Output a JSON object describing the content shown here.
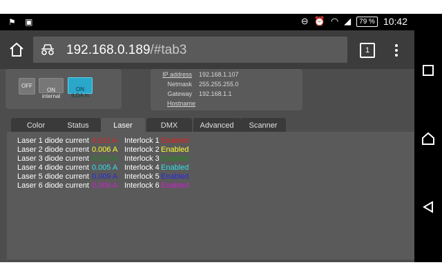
{
  "colors": {
    "status_bar": "#000000",
    "toolbar": "#3c3c3c",
    "content_bg": "#4d4d4d",
    "panel_bg": "#5a5a5a",
    "active_button": "#2aa7c9"
  },
  "statusbar": {
    "battery": "79 %",
    "time": "10:42",
    "icons": [
      "notification-icon",
      "image-icon",
      "do-not-disturb-icon",
      "alarm-icon",
      "wifi-icon",
      "signal-icon",
      "battery-icon"
    ]
  },
  "toolbar": {
    "url_host": "192.168.0.189",
    "url_fragment": "/#tab3",
    "tab_count": "1"
  },
  "mode_buttons": [
    {
      "label": "OFF",
      "active": false
    },
    {
      "label": "ON\ninternal",
      "active": false
    },
    {
      "label": "ON\nILDA in",
      "active": true
    }
  ],
  "network": [
    {
      "label": "IP address",
      "value": "192.168.1.107"
    },
    {
      "label": "Netmask",
      "value": "255.255.255.0"
    },
    {
      "label": "Gateway",
      "value": "192.168.1.1"
    },
    {
      "label": "Hostname",
      "value": ""
    }
  ],
  "tabs": [
    "Color",
    "Status",
    "Laser",
    "DMX",
    "Advanced",
    "Scanner"
  ],
  "active_tab": "Laser",
  "laser_rows": [
    {
      "diode_label": "Laser 1 diode current",
      "current": "0.011 A",
      "current_color": "#e02020",
      "interlock_label": "Interlock 1",
      "interlock_state": "Enabled",
      "state_color": "#e02020"
    },
    {
      "diode_label": "Laser 2 diode current",
      "current": "0.006 A",
      "current_color": "#ffff33",
      "interlock_label": "Interlock 2",
      "interlock_state": "Enabled",
      "state_color": "#ffff33"
    },
    {
      "diode_label": "Laser 3 diode current",
      "current": "0.020 A",
      "current_color": "#1e8c1e",
      "interlock_label": "Interlock 3",
      "interlock_state": "Enabled",
      "state_color": "#1e8c1e"
    },
    {
      "diode_label": "Laser 4 diode current",
      "current": "0.005 A",
      "current_color": "#33e0e6",
      "interlock_label": "Interlock 4",
      "interlock_state": "Enabled",
      "state_color": "#33e0e6"
    },
    {
      "diode_label": "Laser 5 diode current",
      "current": "0.009 A",
      "current_color": "#2a2ae0",
      "interlock_label": "Interlock 5",
      "interlock_state": "Enabled",
      "state_color": "#2a2ae0"
    },
    {
      "diode_label": "Laser 6 diode current",
      "current": "0.006 A",
      "current_color": "#d020d0",
      "interlock_label": "Interlock 6",
      "interlock_state": "Enabled",
      "state_color": "#d020d0"
    }
  ]
}
